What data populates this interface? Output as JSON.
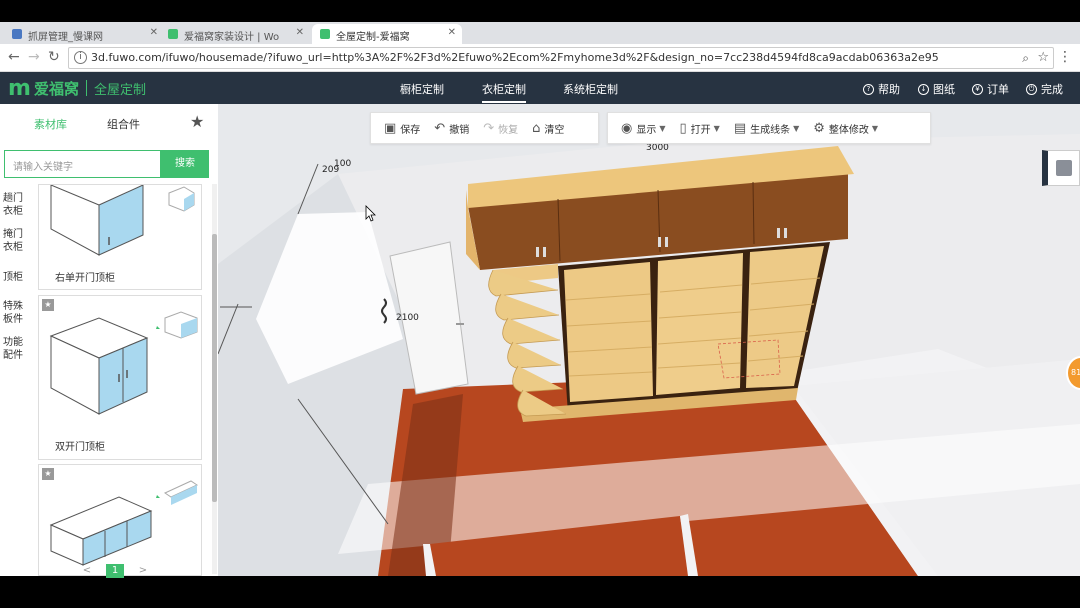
{
  "browser": {
    "tabs": [
      {
        "title": "抓屏管理_慢课网",
        "active": false
      },
      {
        "title": "爱福窝家装设计 | Wo",
        "active": false
      },
      {
        "title": "全屋定制-爱福窝",
        "active": true
      }
    ],
    "url": "3d.fuwo.com/ifuwo/housemade/?ifuwo_url=http%3A%2F%2F3d%2Efuwo%2Ecom%2Fmyhome3d%2F&design_no=7cc238d4594fd8ca9acdab06363a2e95"
  },
  "app": {
    "logo_text": "爱福窝",
    "logo_sub": "全屋定制",
    "nav": [
      {
        "label": "橱柜定制",
        "active": false
      },
      {
        "label": "衣柜定制",
        "active": true
      },
      {
        "label": "系统柜定制",
        "active": false
      }
    ],
    "right_nav": [
      {
        "label": "帮助",
        "icon": "question-icon"
      },
      {
        "label": "图纸",
        "icon": "download-icon"
      },
      {
        "label": "订单",
        "icon": "order-icon"
      },
      {
        "label": "完成",
        "icon": "power-icon"
      }
    ]
  },
  "sidebar": {
    "tabs": [
      {
        "label": "素材库",
        "active": true
      },
      {
        "label": "组合件",
        "active": false
      }
    ],
    "search_placeholder": "请输入关键字",
    "search_button": "搜索",
    "categories": [
      "趟门衣柜",
      "掩门衣柜",
      "顶柜",
      "特殊板件",
      "功能配件"
    ],
    "items": [
      {
        "label": "右单开门顶柜"
      },
      {
        "label": "双开门顶柜"
      },
      {
        "label": ""
      }
    ],
    "pager": {
      "prev": "<",
      "current": "1",
      "next": ">"
    }
  },
  "toolbar": {
    "left": [
      {
        "label": "保存",
        "icon": "save-icon",
        "enabled": true
      },
      {
        "label": "撤销",
        "icon": "undo-icon",
        "enabled": true
      },
      {
        "label": "恢复",
        "icon": "redo-icon",
        "enabled": false
      },
      {
        "label": "清空",
        "icon": "clear-icon",
        "enabled": true
      }
    ],
    "right": [
      {
        "label": "显示",
        "icon": "eye-icon"
      },
      {
        "label": "打开",
        "icon": "door-icon"
      },
      {
        "label": "生成线条",
        "icon": "lines-icon"
      },
      {
        "label": "整体修改",
        "icon": "gear-icon"
      }
    ]
  },
  "scene": {
    "dim_width": "3000",
    "dim_depth": "209",
    "dim_small": "100",
    "dim_height": "2100",
    "badge": "81"
  },
  "colors": {
    "brand_green": "#3fbf6f",
    "appbar_bg": "#273341",
    "wood_light": "#eccb86",
    "floor": "#b7471f"
  }
}
